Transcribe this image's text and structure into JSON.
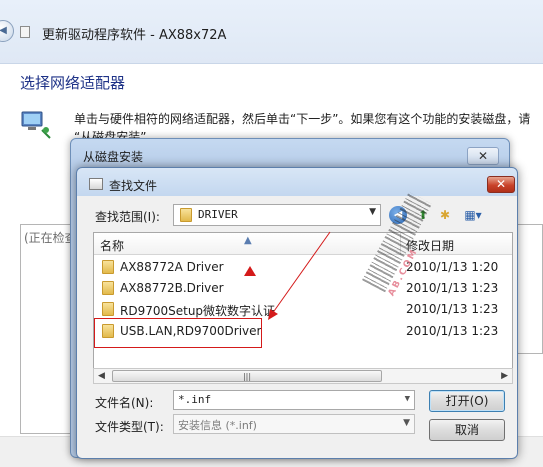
{
  "main_window": {
    "title": "更新驱动程序软件 - AX88x72A",
    "heading": "选择网络适配器",
    "description_line1": "单击与硬件相符的网络适配器，然后单击“下一步”。如果您有这个功能的安装磁盘，请",
    "description_line2": "“从磁盘安装”。",
    "search_status": "(正在检查"
  },
  "disk_dialog": {
    "title": "从磁盘安装",
    "close_label": "✕"
  },
  "find_dialog": {
    "title": "查找文件",
    "close_label": "✕",
    "look_in_label": "查找范围(I):",
    "look_in_value": "DRIVER",
    "column_name": "名称",
    "column_date": "修改日期",
    "rows": [
      {
        "name": "AX88772A Driver",
        "date": "2010/1/13 1:20"
      },
      {
        "name": "AX88772B.Driver",
        "date": "2010/1/13 1:23"
      },
      {
        "name": "RD9700Setup微软数字认证",
        "date": "2010/1/13 1:23"
      },
      {
        "name": "USB.LAN,RD9700Driver",
        "date": "2010/1/13 1:23"
      }
    ],
    "filename_label": "文件名(N):",
    "filename_value": "*.inf",
    "filetype_label": "文件类型(T):",
    "filetype_value": "安装信息 (*.inf)",
    "open_label": "打开(O)",
    "cancel_label": "取消"
  },
  "watermark": {
    "text": "AB.COM"
  },
  "colors": {
    "annotation_red": "#d41a1a",
    "title_blue": "#1e3287"
  }
}
